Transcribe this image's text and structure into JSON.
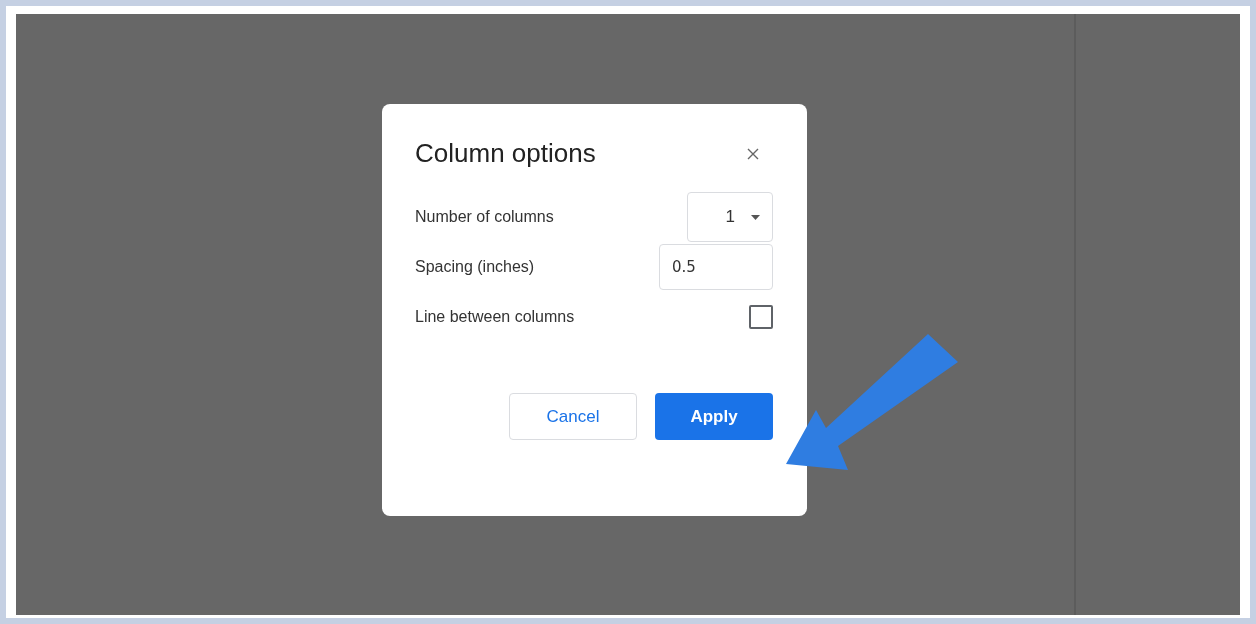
{
  "dialog": {
    "title": "Column options",
    "rows": [
      {
        "kind": "dropdown",
        "label": "Number of columns",
        "value": "1"
      },
      {
        "kind": "input",
        "label": "Spacing (inches)",
        "value": "0.5"
      },
      {
        "kind": "checkbox",
        "label": "Line between columns",
        "checked": false
      }
    ],
    "buttons": [
      {
        "label": "Cancel",
        "kind": "secondary"
      },
      {
        "label": "Apply",
        "kind": "primary"
      }
    ]
  }
}
